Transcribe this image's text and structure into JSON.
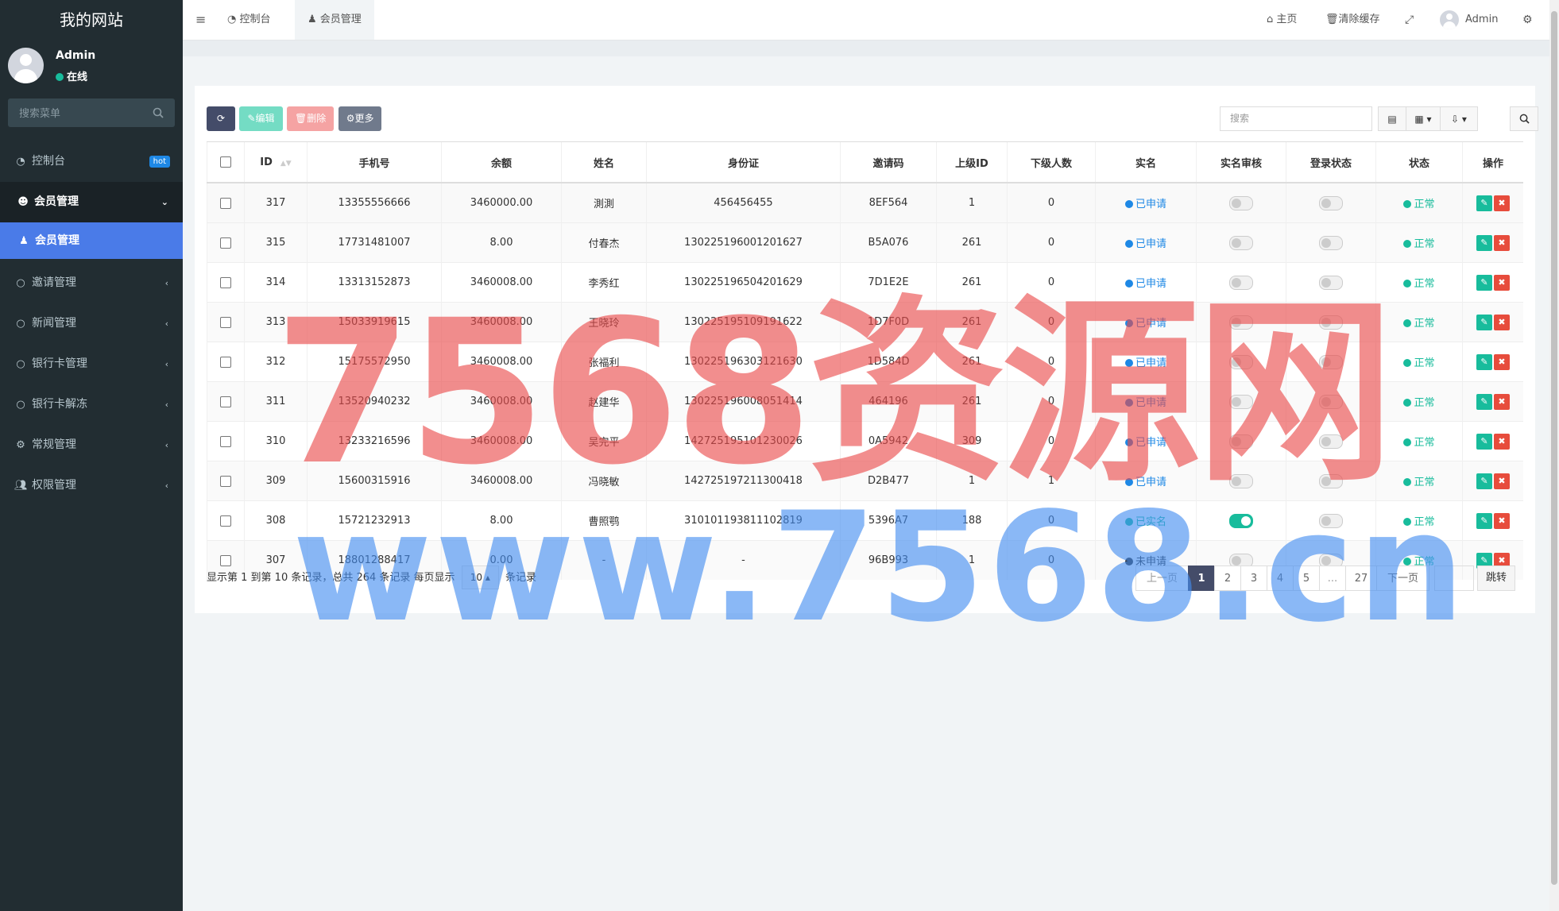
{
  "sidebar": {
    "brand": "我的网站",
    "user_name": "Admin",
    "user_status": "在线",
    "search_placeholder": "搜索菜单",
    "items": [
      {
        "label": "控制台",
        "badge": "hot"
      },
      {
        "label": "会员管理"
      },
      {
        "label": "会员管理"
      },
      {
        "label": "邀请管理"
      },
      {
        "label": "新闻管理"
      },
      {
        "label": "银行卡管理"
      },
      {
        "label": "银行卡解冻"
      },
      {
        "label": "常规管理"
      },
      {
        "label": "权限管理"
      }
    ]
  },
  "topnav": {
    "tabs": [
      "控制台",
      "会员管理"
    ],
    "home": "主页",
    "clear_cache": "清除缓存",
    "admin": "Admin"
  },
  "toolbar": {
    "edit": "编辑",
    "delete": "删除",
    "more": "更多",
    "search_placeholder": "搜索"
  },
  "table": {
    "headers": [
      "ID",
      "手机号",
      "余额",
      "姓名",
      "身份证",
      "邀请码",
      "上级ID",
      "下级人数",
      "实名",
      "实名审核",
      "登录状态",
      "状态",
      "操作"
    ],
    "rows": [
      {
        "id": "317",
        "phone": "13355556666",
        "balance": "3460000.00",
        "name": "測測",
        "idcard": "456456455",
        "code": "8EF564",
        "parent": "1",
        "children": "0",
        "real": "已申请",
        "real_color": "#1e88e5",
        "audit": false,
        "login": false,
        "status": "正常"
      },
      {
        "id": "315",
        "phone": "17731481007",
        "balance": "8.00",
        "name": "付春杰",
        "idcard": "130225196001201627",
        "code": "B5A076",
        "parent": "261",
        "children": "0",
        "real": "已申请",
        "real_color": "#1e88e5",
        "audit": false,
        "login": false,
        "status": "正常"
      },
      {
        "id": "314",
        "phone": "13313152873",
        "balance": "3460008.00",
        "name": "李秀红",
        "idcard": "130225196504201629",
        "code": "7D1E2E",
        "parent": "261",
        "children": "0",
        "real": "已申请",
        "real_color": "#1e88e5",
        "audit": false,
        "login": false,
        "status": "正常"
      },
      {
        "id": "313",
        "phone": "15033919615",
        "balance": "3460008.00",
        "name": "王晓玲",
        "idcard": "130225195109191622",
        "code": "1D7F0D",
        "parent": "261",
        "children": "0",
        "real": "已申请",
        "real_color": "#1e88e5",
        "audit": false,
        "login": false,
        "status": "正常"
      },
      {
        "id": "312",
        "phone": "15175572950",
        "balance": "3460008.00",
        "name": "张福利",
        "idcard": "130225196303121630",
        "code": "1D584D",
        "parent": "261",
        "children": "0",
        "real": "已申请",
        "real_color": "#1e88e5",
        "audit": false,
        "login": false,
        "status": "正常"
      },
      {
        "id": "311",
        "phone": "13520940232",
        "balance": "3460008.00",
        "name": "赵建华",
        "idcard": "130225196008051414",
        "code": "464196",
        "parent": "261",
        "children": "0",
        "real": "已申请",
        "real_color": "#1e88e5",
        "audit": false,
        "login": false,
        "status": "正常"
      },
      {
        "id": "310",
        "phone": "13233216596",
        "balance": "3460008.00",
        "name": "吴完平",
        "idcard": "142725195101230026",
        "code": "0A5942",
        "parent": "309",
        "children": "0",
        "real": "已申请",
        "real_color": "#1e88e5",
        "audit": false,
        "login": false,
        "status": "正常"
      },
      {
        "id": "309",
        "phone": "15600315916",
        "balance": "3460008.00",
        "name": "冯晓敏",
        "idcard": "142725197211300418",
        "code": "D2B477",
        "parent": "1",
        "children": "1",
        "real": "已申请",
        "real_color": "#1e88e5",
        "audit": false,
        "login": false,
        "status": "正常"
      },
      {
        "id": "308",
        "phone": "15721232913",
        "balance": "8.00",
        "name": "曹照鹗",
        "idcard": "310101193811102819",
        "code": "5396A7",
        "parent": "188",
        "children": "0",
        "real": "已实名",
        "real_color": "#18bc9c",
        "audit": true,
        "login": false,
        "status": "正常"
      },
      {
        "id": "307",
        "phone": "18801288417",
        "balance": "0.00",
        "name": "-",
        "idcard": "-",
        "code": "96B993",
        "parent": "1",
        "children": "0",
        "real": "未申请",
        "real_color": "#333333",
        "audit": false,
        "login": false,
        "status": "正常"
      }
    ]
  },
  "pagination": {
    "info_prefix": "显示第 1 到第 10 条记录，总共 264 条记录 每页显示",
    "page_size": "10",
    "info_suffix": "条记录",
    "prev": "上一页",
    "pages": [
      "1",
      "2",
      "3",
      "4",
      "5",
      "...",
      "27"
    ],
    "next": "下一页",
    "go": "跳转"
  },
  "watermark": {
    "line1": "7568资源网",
    "line2": "www.7568.cn"
  },
  "colors": {
    "sidebar_bg": "#222d32",
    "active_sub": "#4a7be8",
    "accent_green": "#18bc9c",
    "accent_blue": "#1e88e5",
    "danger": "#e74c3c"
  }
}
